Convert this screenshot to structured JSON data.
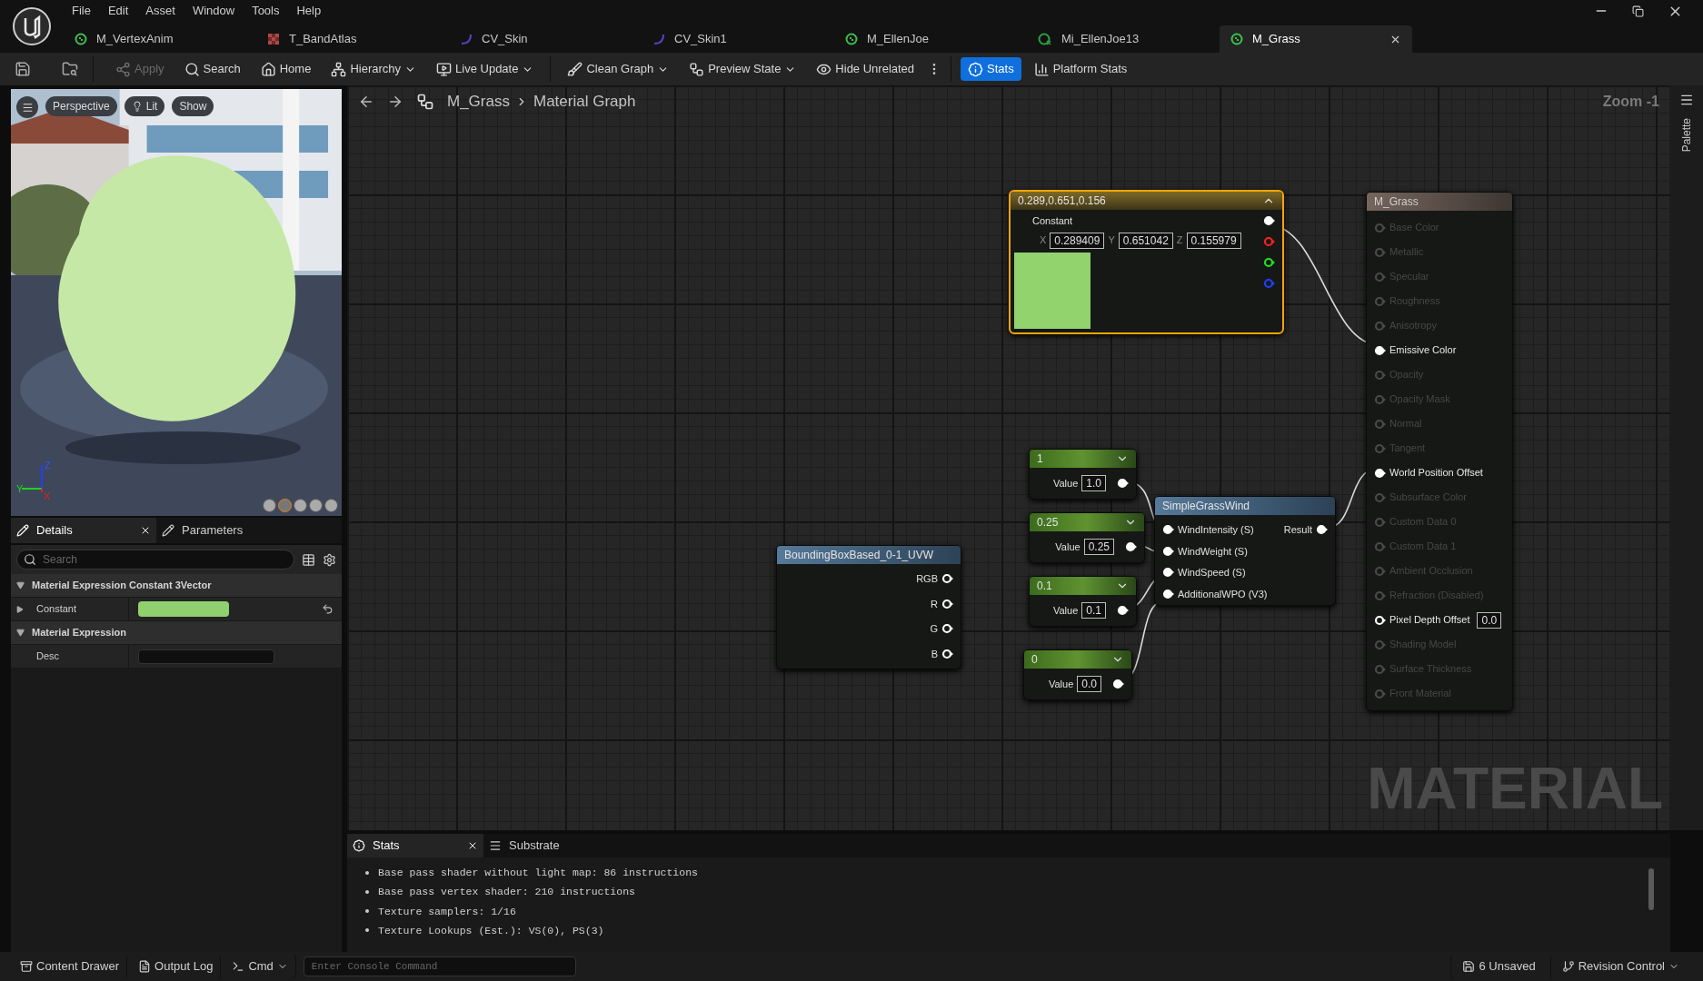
{
  "menu": [
    "File",
    "Edit",
    "Asset",
    "Window",
    "Tools",
    "Help"
  ],
  "doc_tabs": [
    {
      "label": "M_VertexAnim",
      "kind": "material",
      "selected": false
    },
    {
      "label": "T_BandAtlas",
      "kind": "texture",
      "selected": false
    },
    {
      "label": "CV_Skin",
      "kind": "curve",
      "selected": false
    },
    {
      "label": "CV_Skin1",
      "kind": "curve",
      "selected": false
    },
    {
      "label": "M_EllenJoe",
      "kind": "material",
      "selected": false
    },
    {
      "label": "Mi_EllenJoe13",
      "kind": "instance",
      "selected": false
    },
    {
      "label": "M_Grass",
      "kind": "material",
      "selected": true
    }
  ],
  "toolbar": [
    {
      "label": "Apply",
      "disabled": true,
      "dropdown": false,
      "selected": false
    },
    {
      "label": "Search",
      "disabled": false,
      "dropdown": false,
      "selected": false
    },
    {
      "label": "Home",
      "disabled": false,
      "dropdown": false,
      "selected": false
    },
    {
      "label": "Hierarchy",
      "disabled": false,
      "dropdown": true,
      "selected": false
    },
    {
      "label": "Live Update",
      "disabled": false,
      "dropdown": true,
      "selected": false
    },
    {
      "label": "Clean Graph",
      "disabled": false,
      "dropdown": true,
      "selected": false
    },
    {
      "label": "Preview State",
      "disabled": false,
      "dropdown": true,
      "selected": false
    },
    {
      "label": "Hide Unrelated",
      "disabled": false,
      "dropdown": false,
      "selected": false
    },
    {
      "label": "Stats",
      "disabled": false,
      "dropdown": false,
      "selected": true
    },
    {
      "label": "Platform Stats",
      "disabled": false,
      "dropdown": false,
      "selected": false
    }
  ],
  "viewport": {
    "buttons": [
      "Perspective",
      "Lit",
      "Show"
    ],
    "axis_labels": [
      "Z",
      "Y",
      "X"
    ]
  },
  "details": {
    "tabs": [
      {
        "label": "Details",
        "selected": true,
        "closable": true
      },
      {
        "label": "Parameters",
        "selected": false,
        "closable": false
      }
    ],
    "search": {
      "placeholder": "Search"
    },
    "sections": [
      {
        "title": "Material Expression Constant 3Vector",
        "expanded": true,
        "rows": [
          {
            "label": "Constant",
            "kind": "color",
            "color": "#8fd16f",
            "expanded": false
          }
        ]
      },
      {
        "title": "Material Expression",
        "expanded": true,
        "rows": [
          {
            "label": "Desc",
            "kind": "text"
          }
        ]
      }
    ]
  },
  "graph": {
    "breadcrumb": [
      "M_Grass",
      "Material Graph"
    ],
    "zoom": "Zoom -1",
    "watermark": "MATERIAL",
    "palette_label": "Palette",
    "nodes": [
      {
        "kind": "constant3",
        "title": "0.289,0.651,0.156",
        "selected": true,
        "label": "Constant",
        "fields": [
          {
            "axis": "X",
            "value": "0.289409"
          },
          {
            "axis": "Y",
            "value": "0.651042"
          },
          {
            "axis": "Z",
            "value": "0.155979"
          }
        ],
        "outputs": [
          {
            "color": "#ffffff",
            "connected": true
          },
          {
            "color": "#ff2020",
            "connected": false
          },
          {
            "color": "#20e020",
            "connected": false
          },
          {
            "color": "#2040ff",
            "connected": false
          }
        ]
      },
      {
        "kind": "result",
        "title": "M_Grass",
        "selected": false,
        "pins": [
          {
            "label": "Base Color",
            "enabled": false,
            "connected": false
          },
          {
            "label": "Metallic",
            "enabled": false,
            "connected": false
          },
          {
            "label": "Specular",
            "enabled": false,
            "connected": false
          },
          {
            "label": "Roughness",
            "enabled": false,
            "connected": false
          },
          {
            "label": "Anisotropy",
            "enabled": false,
            "connected": false
          },
          {
            "label": "Emissive Color",
            "enabled": true,
            "connected": true
          },
          {
            "label": "Opacity",
            "enabled": false,
            "connected": false
          },
          {
            "label": "Opacity Mask",
            "enabled": false,
            "connected": false
          },
          {
            "label": "Normal",
            "enabled": false,
            "connected": false
          },
          {
            "label": "Tangent",
            "enabled": false,
            "connected": false
          },
          {
            "label": "World Position Offset",
            "enabled": true,
            "connected": true
          },
          {
            "label": "Subsurface Color",
            "enabled": false,
            "connected": false
          },
          {
            "label": "Custom Data 0",
            "enabled": false,
            "connected": false
          },
          {
            "label": "Custom Data 1",
            "enabled": false,
            "connected": false
          },
          {
            "label": "Ambient Occlusion",
            "enabled": false,
            "connected": false
          },
          {
            "label": "Refraction (Disabled)",
            "enabled": false,
            "connected": false
          },
          {
            "label": "Pixel Depth Offset",
            "enabled": true,
            "connected": false,
            "value": "0.0"
          },
          {
            "label": "Shading Model",
            "enabled": false,
            "connected": false
          },
          {
            "label": "Surface Thickness",
            "enabled": false,
            "connected": false
          },
          {
            "label": "Front Material",
            "enabled": false,
            "connected": false
          }
        ]
      },
      {
        "kind": "scalar",
        "title": "1",
        "selected": false,
        "label": "Value",
        "value": "1.0"
      },
      {
        "kind": "scalar",
        "title": "0.25",
        "selected": false,
        "label": "Value",
        "value": "0.25"
      },
      {
        "kind": "scalar",
        "title": "0.1",
        "selected": false,
        "label": "Value",
        "value": "0.1"
      },
      {
        "kind": "scalar",
        "title": "0",
        "selected": false,
        "label": "Value",
        "value": "0.0"
      },
      {
        "kind": "function",
        "title": "SimpleGrassWind",
        "selected": false,
        "inputs": [
          {
            "label": "WindIntensity (S)",
            "connected": true
          },
          {
            "label": "WindWeight (S)",
            "connected": true
          },
          {
            "label": "WindSpeed (S)",
            "connected": true
          },
          {
            "label": "AdditionalWPO (V3)",
            "connected": true
          }
        ],
        "outputs": [
          {
            "label": "Result",
            "connected": true
          }
        ]
      },
      {
        "kind": "function",
        "title": "BoundingBoxBased_0-1_UVW",
        "selected": false,
        "outputs": [
          {
            "label": "RGB",
            "connected": false
          },
          {
            "label": "R",
            "connected": false
          },
          {
            "label": "G",
            "connected": false
          },
          {
            "label": "B",
            "connected": false
          }
        ]
      }
    ]
  },
  "stats": {
    "tabs": [
      {
        "label": "Stats",
        "selected": true,
        "closable": true
      },
      {
        "label": "Substrate",
        "selected": false,
        "closable": false
      }
    ],
    "lines": [
      "Base pass shader without light map: 86 instructions",
      "Base pass vertex shader: 210 instructions",
      "Texture samplers: 1/16",
      "Texture Lookups (Est.): VS(0), PS(3)"
    ]
  },
  "status_bar": {
    "left": [
      {
        "label": "Content Drawer",
        "dropdown": false
      },
      {
        "label": "Output Log",
        "dropdown": false
      },
      {
        "label": "Cmd",
        "dropdown": true
      }
    ],
    "console": {
      "placeholder": "Enter Console Command"
    },
    "right": [
      {
        "label": "6 Unsaved",
        "dropdown": false
      },
      {
        "label": "Revision Control",
        "dropdown": true
      }
    ]
  }
}
